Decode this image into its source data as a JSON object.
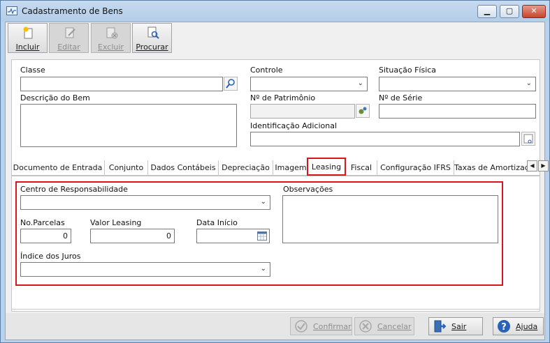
{
  "window": {
    "title": "Cadastramento de Bens"
  },
  "toolbar": {
    "incluir": "Incluir",
    "editar": "Editar",
    "excluir": "Excluir",
    "procurar": "Procurar"
  },
  "form": {
    "classe_label": "Classe",
    "classe_value": "",
    "descricao_label": "Descrição do Bem",
    "descricao_value": "",
    "controle_label": "Controle",
    "controle_value": "",
    "situacao_label": "Situação Física",
    "situacao_value": "",
    "patrimonio_label": "Nº de Patrimônio",
    "patrimonio_value": "",
    "serie_label": "Nº de Série",
    "serie_value": "",
    "identificacao_label": "Identificação Adicional",
    "identificacao_value": ""
  },
  "tabs": [
    {
      "label": "Documento de Entrada"
    },
    {
      "label": "Conjunto"
    },
    {
      "label": "Dados Contábeis"
    },
    {
      "label": "Depreciação"
    },
    {
      "label": "Imagem"
    },
    {
      "label": "Leasing",
      "active": true
    },
    {
      "label": "Fiscal"
    },
    {
      "label": "Configuração IFRS"
    },
    {
      "label": "Taxas de Amortizaçã"
    }
  ],
  "leasing": {
    "centro_label": "Centro de Responsabilidade",
    "centro_value": "",
    "observacoes_label": "Observações",
    "observacoes_value": "",
    "parcelas_label": "No.Parcelas",
    "parcelas_value": "0",
    "valor_label": "Valor Leasing",
    "valor_value": "0",
    "data_label": "Data Início",
    "data_value": "",
    "indice_label": "Índice dos Juros",
    "indice_value": ""
  },
  "footer": {
    "confirmar": "Confirmar",
    "cancelar": "Cancelar",
    "sair": "Sair",
    "ajuda": "Ajuda"
  },
  "colors": {
    "highlight": "#d8141c",
    "window_frame": "#b9d1ea",
    "client_bg": "#f0f0f0"
  }
}
